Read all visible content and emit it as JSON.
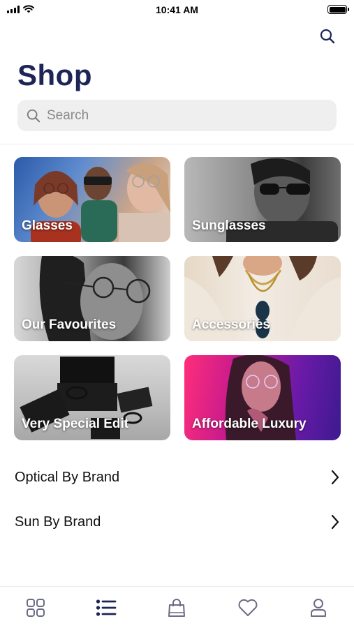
{
  "status_bar": {
    "time": "10:41 AM"
  },
  "header": {
    "title": "Shop"
  },
  "search": {
    "placeholder": "Search",
    "value": ""
  },
  "categories": [
    {
      "label": "Glasses"
    },
    {
      "label": "Sunglasses"
    },
    {
      "label": "Our Favourites"
    },
    {
      "label": "Accessories"
    },
    {
      "label": "Very Special Edit"
    },
    {
      "label": "Affordable Luxury"
    }
  ],
  "links": [
    {
      "label": "Optical By Brand"
    },
    {
      "label": "Sun By Brand"
    }
  ],
  "tab_bar": {
    "tabs": [
      {
        "icon": "grid-icon",
        "active": false
      },
      {
        "icon": "list-icon",
        "active": true
      },
      {
        "icon": "shopping-bag-icon",
        "active": false
      },
      {
        "icon": "heart-icon",
        "active": false
      },
      {
        "icon": "profile-icon",
        "active": false
      }
    ]
  },
  "colors": {
    "brand": "#1d2456",
    "inactive_icon": "#6b6b85",
    "search_bg": "#efefef"
  }
}
